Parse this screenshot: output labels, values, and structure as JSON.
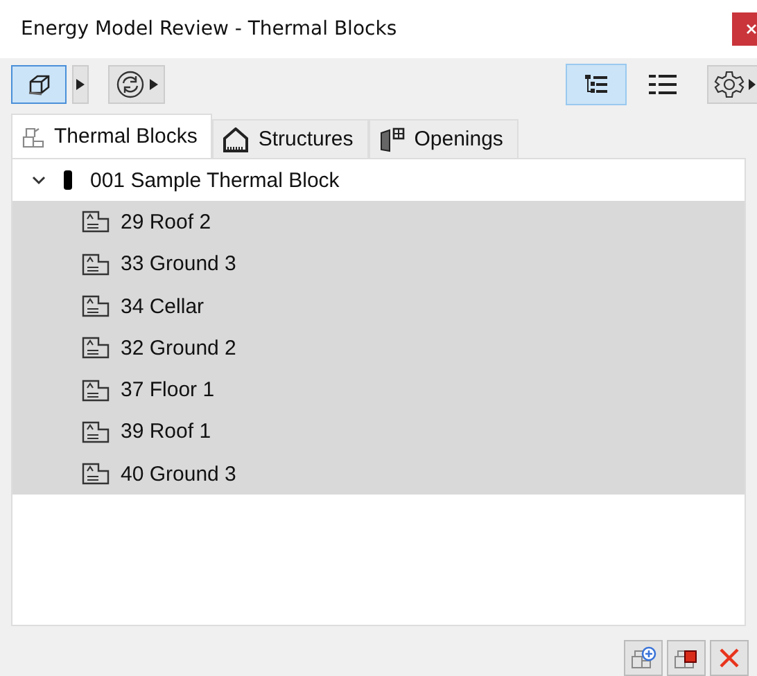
{
  "window": {
    "title": "Energy Model Review - Thermal Blocks"
  },
  "toolbar": {
    "view_modes": [
      {
        "kind": "tree",
        "selected": true
      },
      {
        "kind": "list",
        "selected": false
      }
    ]
  },
  "tabs": [
    {
      "label": "Thermal Blocks",
      "kind": "blocks",
      "selected": true
    },
    {
      "label": "Structures",
      "kind": "structures",
      "selected": false
    },
    {
      "label": "Openings",
      "kind": "openings",
      "selected": false
    }
  ],
  "tree": [
    {
      "label": "001 Sample Thermal Block",
      "expanded": true,
      "selected": false,
      "children": [
        {
          "label": "29 Roof 2",
          "selected": true
        },
        {
          "label": "33 Ground 3",
          "selected": true
        },
        {
          "label": "34 Cellar",
          "selected": true
        },
        {
          "label": "32 Ground 2",
          "selected": true
        },
        {
          "label": "37 Floor 1",
          "selected": true
        },
        {
          "label": "39 Roof 1",
          "selected": true
        },
        {
          "label": "40 Ground 3",
          "selected": true
        }
      ]
    }
  ]
}
